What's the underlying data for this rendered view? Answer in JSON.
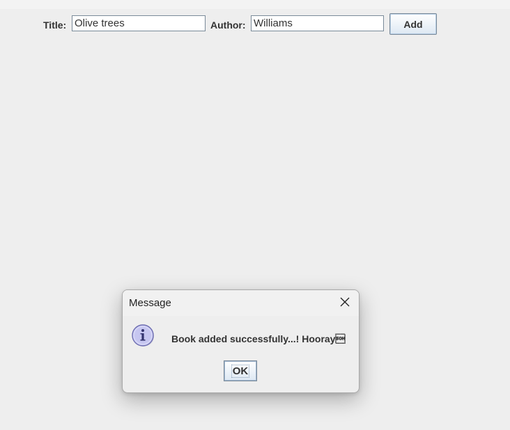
{
  "form": {
    "title_label": "Title:",
    "title_value": "Olive trees",
    "author_label": "Author:",
    "author_value": "Williams",
    "add_label": "Add"
  },
  "dialog": {
    "title": "Message",
    "message": "Book added successfully...! Hooray\u0001",
    "ok_label": "OK",
    "icon": "info-icon",
    "close_icon": "close-icon"
  },
  "colors": {
    "background": "#eeeeee",
    "button_gradient_top": "#ffffff",
    "button_gradient_bottom": "#dde8f3",
    "info_icon_fill": "#c9c9f2"
  }
}
